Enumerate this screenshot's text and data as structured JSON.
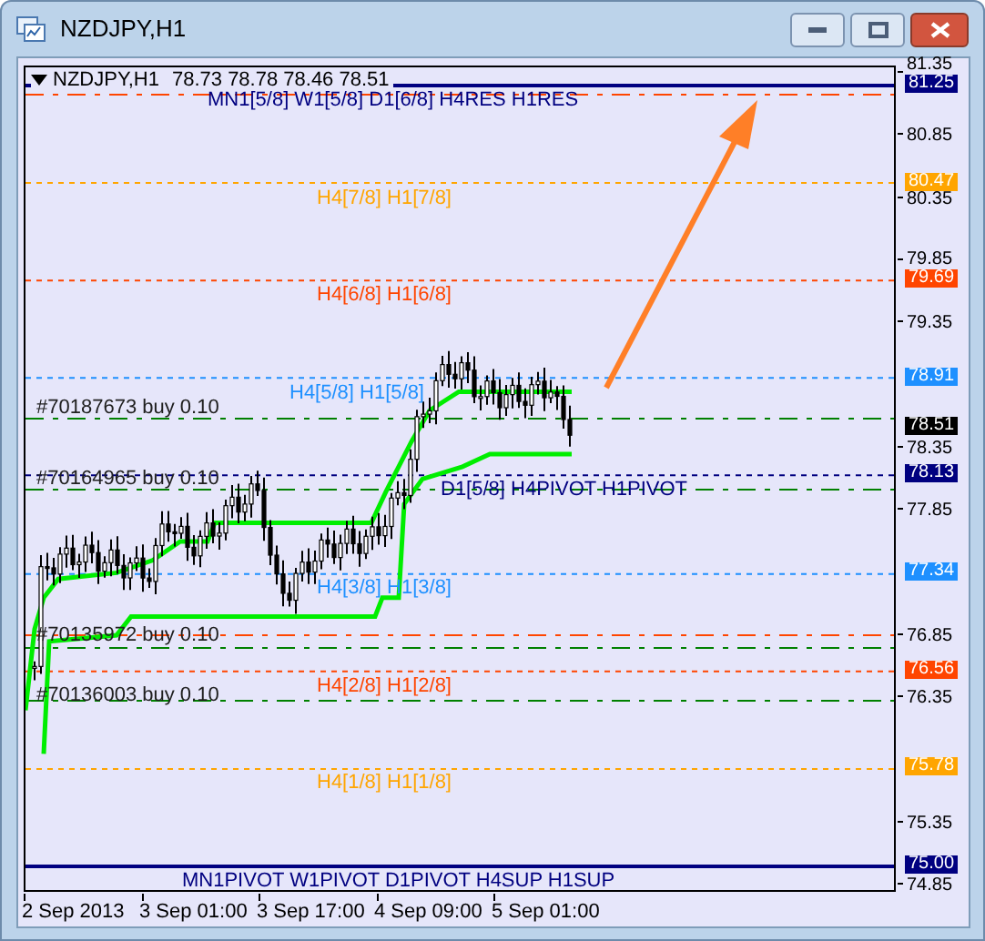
{
  "window": {
    "title": "NZDJPY,H1"
  },
  "chart": {
    "symbol": "NZDJPY,H1",
    "ohlc": "78.73 78.78 78.46 78.51",
    "levels": [
      {
        "kind": "solid",
        "price": "81.25",
        "color": "#000080",
        "label": "MN1[5/8] W1[5/8] D1[6/8] H4RES H1RES"
      },
      {
        "kind": "dotted",
        "price": "80.47",
        "color": "#ffa500",
        "label": "H4[7/8] H1[7/8]"
      },
      {
        "kind": "dotted",
        "price": "79.69",
        "color": "#ff4500",
        "label": "H4[6/8] H1[6/8]"
      },
      {
        "kind": "dotted",
        "price": "78.91",
        "color": "#1e90ff",
        "label": "H4[5/8] H1[5/8]"
      },
      {
        "kind": "current",
        "price": "78.51",
        "color": "#000000"
      },
      {
        "kind": "dotted",
        "price": "78.13",
        "color": "#000080",
        "label": "D1[5/8] H4PIVOT H1PIVOT"
      },
      {
        "kind": "dotted",
        "price": "77.34",
        "color": "#1e90ff",
        "label": "H4[3/8] H1[3/8]"
      },
      {
        "kind": "dotted",
        "price": "76.56",
        "color": "#ff4500",
        "label": "H4[2/8] H1[2/8]"
      },
      {
        "kind": "dotted",
        "price": "75.78",
        "color": "#ffa500",
        "label": "H4[1/8] H1[1/8]"
      },
      {
        "kind": "solid",
        "price": "75.00",
        "color": "#000080",
        "label": "MN1PIVOT W1PIVOT D1PIVOT H4SUP H1SUP"
      }
    ],
    "orders": [
      "#70187673 buy 0.10",
      "#70164965 buy 0.10",
      "#70135972 buy 0.10",
      "#70136003 buy 0.10"
    ],
    "price_ticks": [
      "81.35",
      "80.85",
      "80.35",
      "79.85",
      "79.35",
      "78.35",
      "77.85",
      "76.85",
      "76.35",
      "75.35",
      "74.85"
    ],
    "time_labels": [
      "2 Sep 2013",
      "3 Sep 01:00",
      "3 Sep 17:00",
      "4 Sep 09:00",
      "5 Sep 01:00"
    ]
  }
}
